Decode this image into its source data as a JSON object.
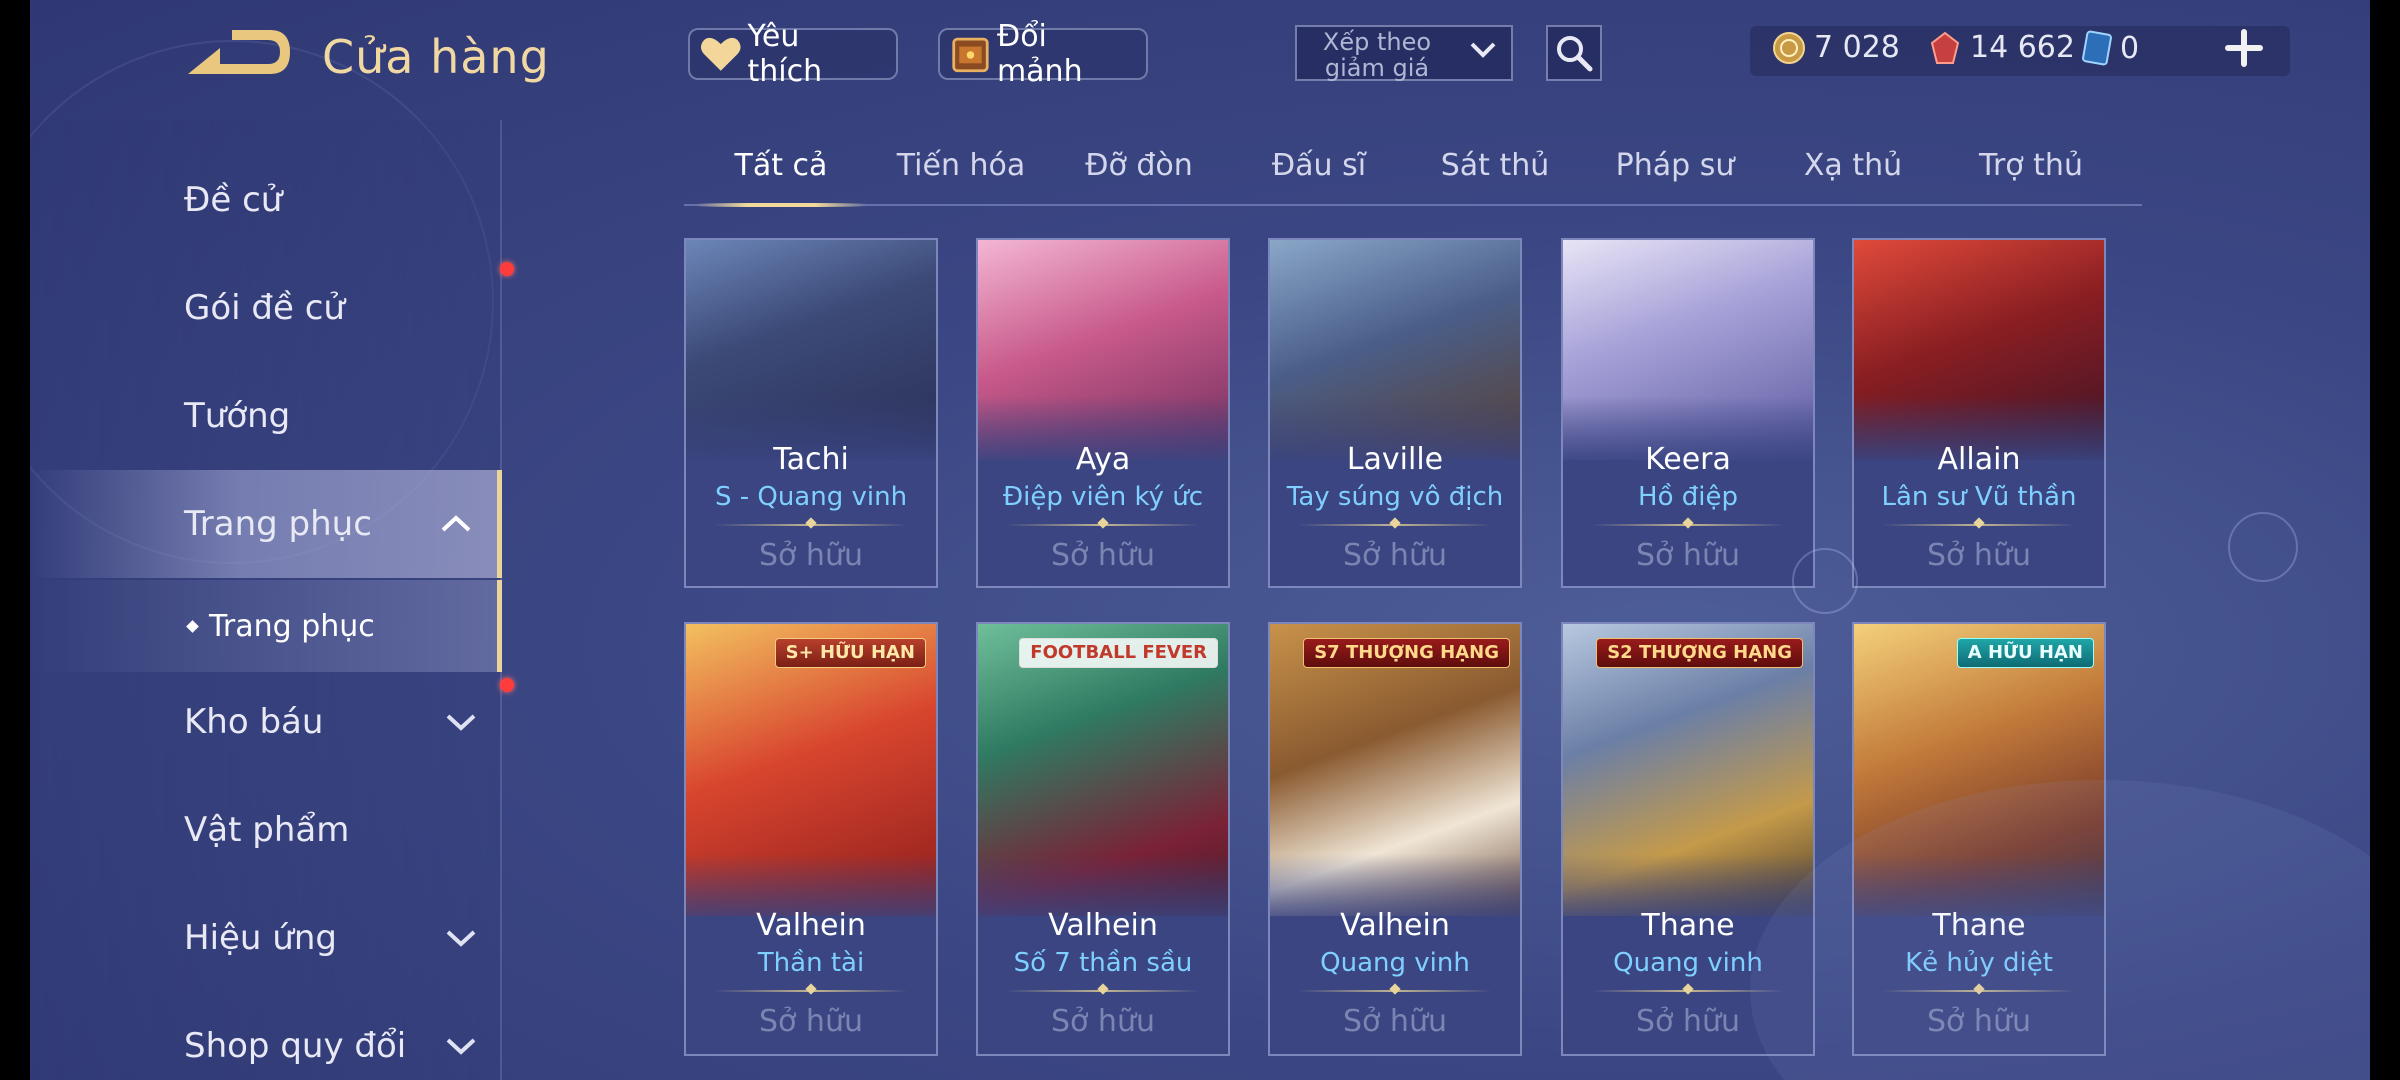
{
  "header": {
    "title": "Cửa hàng",
    "favorite_label": "Yêu thích",
    "fragment_label": "Đổi mảnh",
    "sort_label": "Xếp theo giảm giá"
  },
  "currencies": [
    {
      "icon": "gold-coin-icon",
      "value": "7 028"
    },
    {
      "icon": "ruby-gem-icon",
      "value": "14 662"
    },
    {
      "icon": "voucher-card-icon",
      "value": "0"
    }
  ],
  "sidebar": {
    "items": [
      {
        "label": "Đề cử"
      },
      {
        "label": "Gói đề cử"
      },
      {
        "label": "Tướng"
      },
      {
        "label": "Trang phục"
      },
      {
        "label": "Kho báu"
      },
      {
        "label": "Vật phẩm"
      },
      {
        "label": "Hiệu ứng"
      },
      {
        "label": "Shop quy đổi"
      }
    ],
    "sub_item": "Trang phục"
  },
  "tabs": [
    "Tất cả",
    "Tiến hóa",
    "Đỡ đòn",
    "Đấu sĩ",
    "Sát thủ",
    "Pháp sư",
    "Xạ thủ",
    "Trợ thủ"
  ],
  "cards": [
    {
      "hero": "Tachi",
      "skin": "S - Quang vinh",
      "status": "Sở hữu"
    },
    {
      "hero": "Aya",
      "skin": "Điệp viên ký ức",
      "status": "Sở hữu"
    },
    {
      "hero": "Laville",
      "skin": "Tay súng vô địch",
      "status": "Sở hữu"
    },
    {
      "hero": "Keera",
      "skin": "Hồ điệp",
      "status": "Sở hữu"
    },
    {
      "hero": "Allain",
      "skin": "Lân sư Vũ thần",
      "status": "Sở hữu"
    },
    {
      "hero": "Valhein",
      "skin": "Thần tài",
      "status": "Sở hữu",
      "badge": "S+ HỮU HẠN"
    },
    {
      "hero": "Valhein",
      "skin": "Số 7 thần sầu",
      "status": "Sở hữu",
      "badge": "FOOTBALL FEVER"
    },
    {
      "hero": "Valhein",
      "skin": "Quang vinh",
      "status": "Sở hữu",
      "badge": "S7 THƯỢNG HẠNG"
    },
    {
      "hero": "Thane",
      "skin": "Quang vinh",
      "status": "Sở hữu",
      "badge": "S2 THƯỢNG HẠNG"
    },
    {
      "hero": "Thane",
      "skin": "Kẻ hủy diệt",
      "status": "Sở hữu",
      "badge": "A HỮU HẠN"
    }
  ],
  "colors": {
    "accent_gold": "#f1d8a3",
    "skin_name": "#7fd0ff",
    "owned_text": "#7c84b2",
    "notification": "#ff3b3b"
  }
}
